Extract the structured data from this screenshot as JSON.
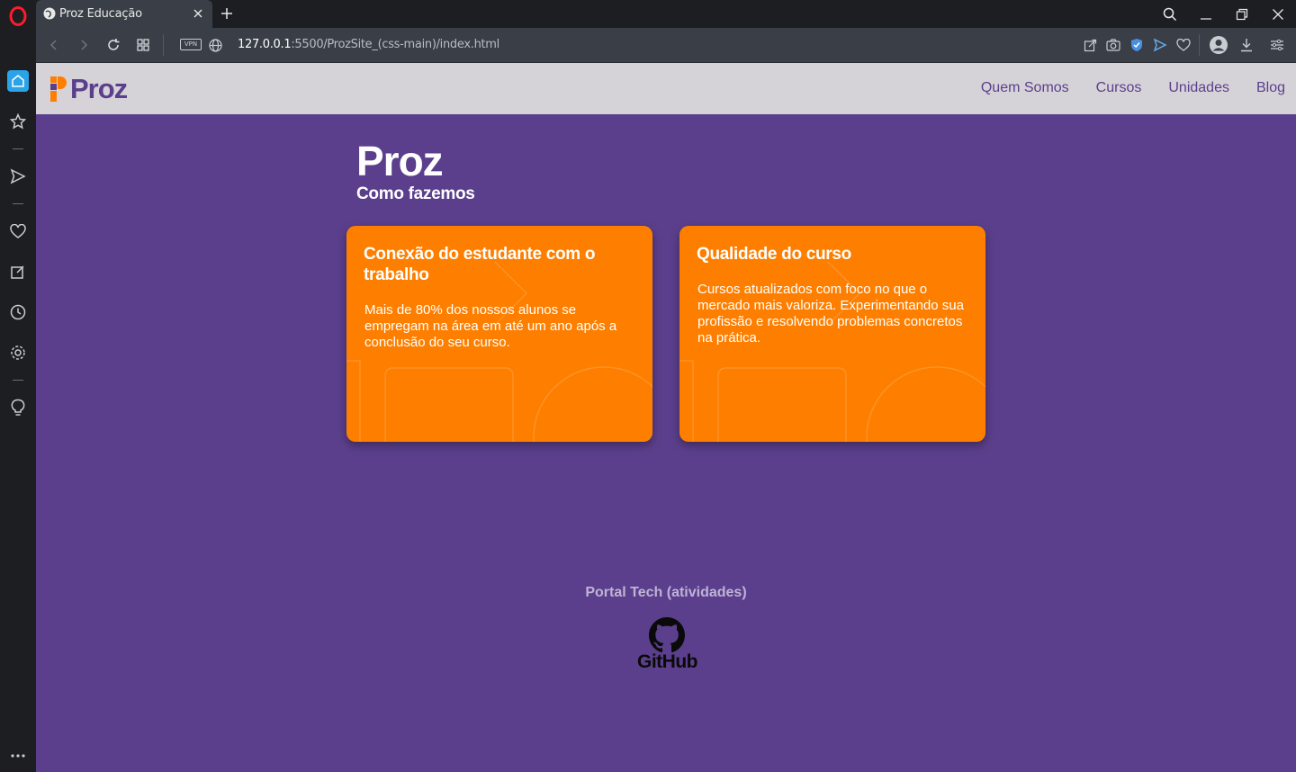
{
  "browser": {
    "tab_title": "Proz Educação",
    "url_host": "127.0.0.1",
    "url_path": ":5500/ProzSite_(css-main)/index.html",
    "vpn_label": "VPN"
  },
  "site": {
    "logo_text": "Proz",
    "menu": [
      {
        "label": "Quem Somos"
      },
      {
        "label": "Cursos"
      },
      {
        "label": "Unidades"
      },
      {
        "label": "Blog"
      }
    ],
    "hero_title": "Proz",
    "hero_subtitle": "Como fazemos",
    "cards": [
      {
        "title": "Conexão do estudante com o trabalho",
        "text": "Mais de 80% dos nossos alunos se empregam na área em até um ano após a conclusão do seu curso."
      },
      {
        "title": "Qualidade do curso",
        "text": "Cursos atualizados com foco no que o mercado mais valoriza. Experimentando sua profissão e resolvendo problemas concretos na prática."
      }
    ],
    "footer_label": "Portal Tech (atividades)",
    "github_label": "GitHub"
  },
  "colors": {
    "purple": "#5b3f8c",
    "orange": "#fe7f00",
    "header_bg": "#d5d3d8"
  },
  "icons": {
    "sidebar": [
      "opera-logo-icon",
      "home-icon",
      "star-icon",
      "send-icon",
      "heart-icon",
      "edit-icon",
      "history-icon",
      "settings-icon",
      "lightbulb-icon",
      "more-icon"
    ],
    "address": [
      "share-icon",
      "camera-icon",
      "shield-icon",
      "send-icon",
      "heart-icon",
      "profile-icon",
      "download-icon",
      "easy-setup-icon"
    ]
  }
}
